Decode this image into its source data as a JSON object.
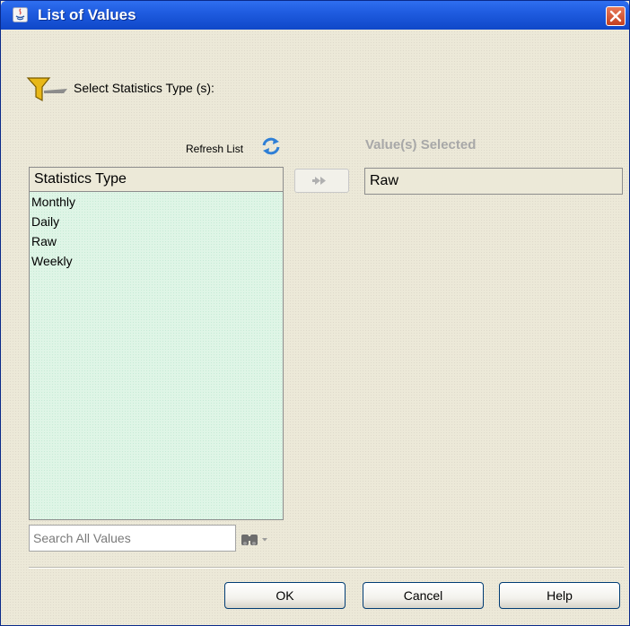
{
  "window": {
    "title": "List of Values",
    "title_color": "#ffffff",
    "titlebar_color": "#1f5ce0"
  },
  "prompt": {
    "label": "Select Statistics Type (s):"
  },
  "refresh": {
    "label": "Refresh List"
  },
  "available": {
    "header": "Statistics Type",
    "items": [
      "Monthly",
      "Daily",
      "Raw",
      "Weekly"
    ],
    "background": "#dff5e6"
  },
  "selected": {
    "heading": "Value(s) Selected",
    "items": [
      "Raw"
    ]
  },
  "search": {
    "placeholder": "Search All Values",
    "value": ""
  },
  "buttons": {
    "ok": "OK",
    "cancel": "Cancel",
    "help": "Help"
  },
  "icons": {
    "app": "java-app-icon",
    "close": "close-icon",
    "filter": "filter-funnel-icon",
    "refresh": "refresh-icon",
    "move": "double-arrow-right-icon",
    "find": "binoculars-icon",
    "dropdown": "chevron-down-icon"
  }
}
